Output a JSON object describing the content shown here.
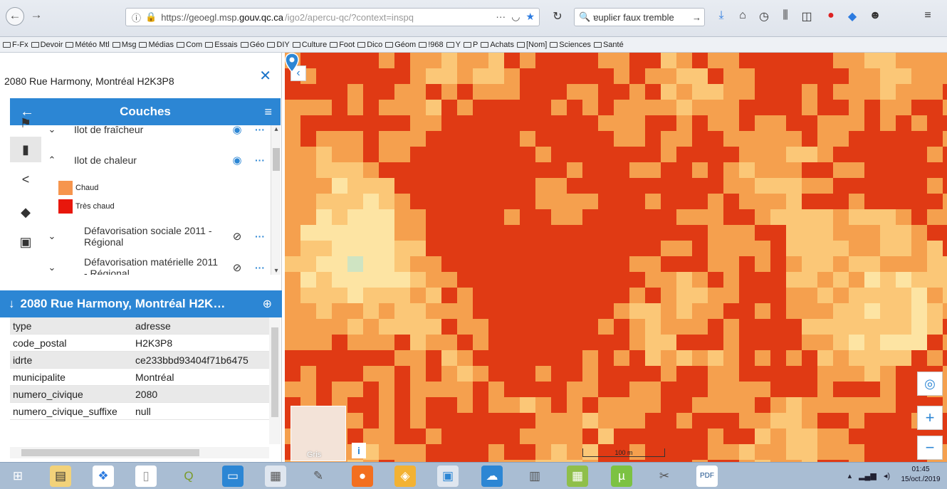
{
  "browser": {
    "url_prefix": "https://geoegl.msp.",
    "url_domain": "gouv.qc.ca",
    "url_path": "/igo2/apercu-qc/?context=inspq",
    "search_text": "ɐupliєr faux tremble",
    "bookmarks": [
      "F-Fx",
      "Devoir",
      "Météo Mtl",
      "Msg",
      "Médias",
      "Com",
      "Essais",
      "Géo",
      "DIY",
      "Culture",
      "Foot",
      "Dico",
      "Géom",
      "!968",
      "Y",
      "P",
      "Achats",
      "[Nom]",
      "Sciences",
      "Santé"
    ]
  },
  "panel": {
    "address_title": "2080  Rue Harmony, Montréal H2K3P8",
    "layers_title": "Couches",
    "layers": [
      {
        "name": "Ilot de fraîcheur"
      },
      {
        "name": "Ilot de chaleur"
      },
      {
        "name": "Défavorisation sociale 2011 - Régional"
      },
      {
        "name": "Défavorisation matérielle 2011 - Régional"
      }
    ],
    "legend": [
      {
        "label": "Chaud",
        "color": "#f6954d"
      },
      {
        "label": "Très chaud",
        "color": "#e8170c"
      }
    ],
    "result_title": "2080 Rue Harmony, Montréal H2K…",
    "properties": [
      {
        "key": "type",
        "value": "adresse"
      },
      {
        "key": "code_postal",
        "value": "H2K3P8"
      },
      {
        "key": "idrte",
        "value": "ce233bbd93404f71b6475"
      },
      {
        "key": "municipalite",
        "value": "Montréal"
      },
      {
        "key": "numero_civique",
        "value": "2080"
      },
      {
        "key": "numero_civique_suffixe",
        "value": "null"
      }
    ]
  },
  "map": {
    "basemap_label": "Gris",
    "info_label": "i",
    "scale_label": "100 m",
    "colors": {
      "very_hot": "#e03a14",
      "hot": "#f5a04e",
      "warm": "#fbc777",
      "mild": "#fde4a3",
      "cool": "#cfe4c2"
    }
  },
  "taskbar": {
    "time": "01:45",
    "date": "15/oct./2019"
  }
}
